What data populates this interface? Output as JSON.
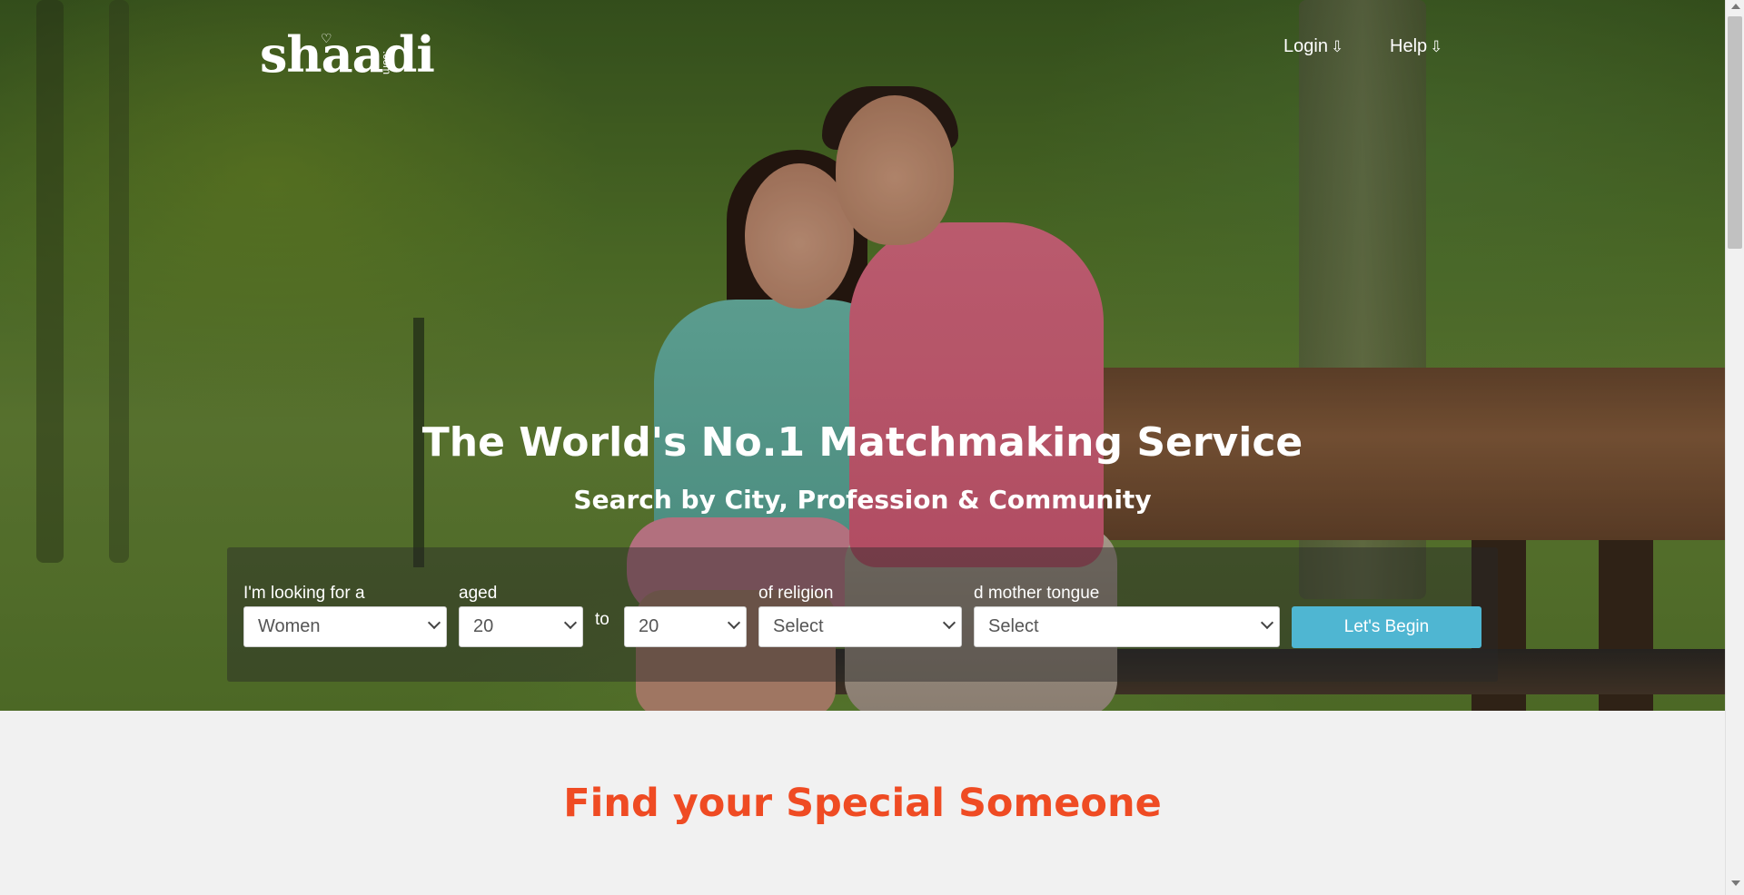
{
  "header": {
    "logo_text": "shaadi",
    "logo_suffix": ".com",
    "nav": [
      {
        "label": "Login",
        "icon": "down-arrow-icon",
        "arrow": "⇩"
      },
      {
        "label": "Help",
        "icon": "down-arrow-icon",
        "arrow": "⇩"
      }
    ]
  },
  "hero": {
    "headline": "The World's No.1 Matchmaking Service",
    "subheadline": "Search by City, Profession & Community"
  },
  "search": {
    "looking_for": {
      "label": "I'm looking for a",
      "value": "Women"
    },
    "age_from": {
      "label": "aged",
      "value": "20"
    },
    "to_label": "to",
    "age_to": {
      "value": "20"
    },
    "religion": {
      "label": "of religion",
      "value": "Select"
    },
    "mother_tongue": {
      "label": "d mother tongue",
      "value": "Select"
    },
    "submit_label": "Let's Begin"
  },
  "section": {
    "title": "Find your Special Someone"
  },
  "colors": {
    "accent_button": "#4fb6d2",
    "section_title": "#ef4b23",
    "page_background": "#f1f1f1"
  }
}
